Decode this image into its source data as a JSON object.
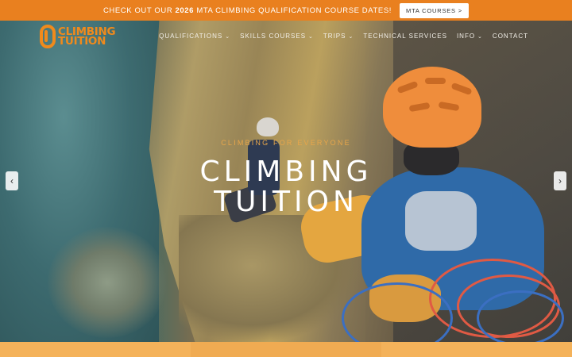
{
  "banner": {
    "text_prefix": "CHECK OUT OUR ",
    "text_bold": "2026",
    "text_suffix": " MTA CLIMBING QUALIFICATION COURSE DATES!",
    "button_label": "MTA COURSES",
    "button_arrow": ">",
    "background": "#e9801f"
  },
  "logo": {
    "line1": "CLIMBING",
    "line2": "TUITION",
    "color": "#f08a1c",
    "icon": "carabiner-icon"
  },
  "nav": {
    "items": [
      {
        "label": "QUALIFICATIONS",
        "chevron": "⌄"
      },
      {
        "label": "SKILLS COURSES",
        "chevron": "⌄"
      },
      {
        "label": "TRIPS",
        "chevron": "⌄"
      },
      {
        "label": "TECHNICAL SERVICES",
        "chevron": ""
      },
      {
        "label": "INFO",
        "chevron": "⌄"
      },
      {
        "label": "CONTACT",
        "chevron": ""
      }
    ]
  },
  "hero": {
    "tagline": "CLIMBING FOR EVERYONE",
    "title_line1": "CLIMBING",
    "title_line2": "TUITION",
    "arrow_left": "‹",
    "arrow_right": "›",
    "accent_color": "#e8a64a"
  },
  "tiles": {
    "colors": [
      "#f4b25a",
      "#f0ab52",
      "#f4b25a"
    ]
  }
}
